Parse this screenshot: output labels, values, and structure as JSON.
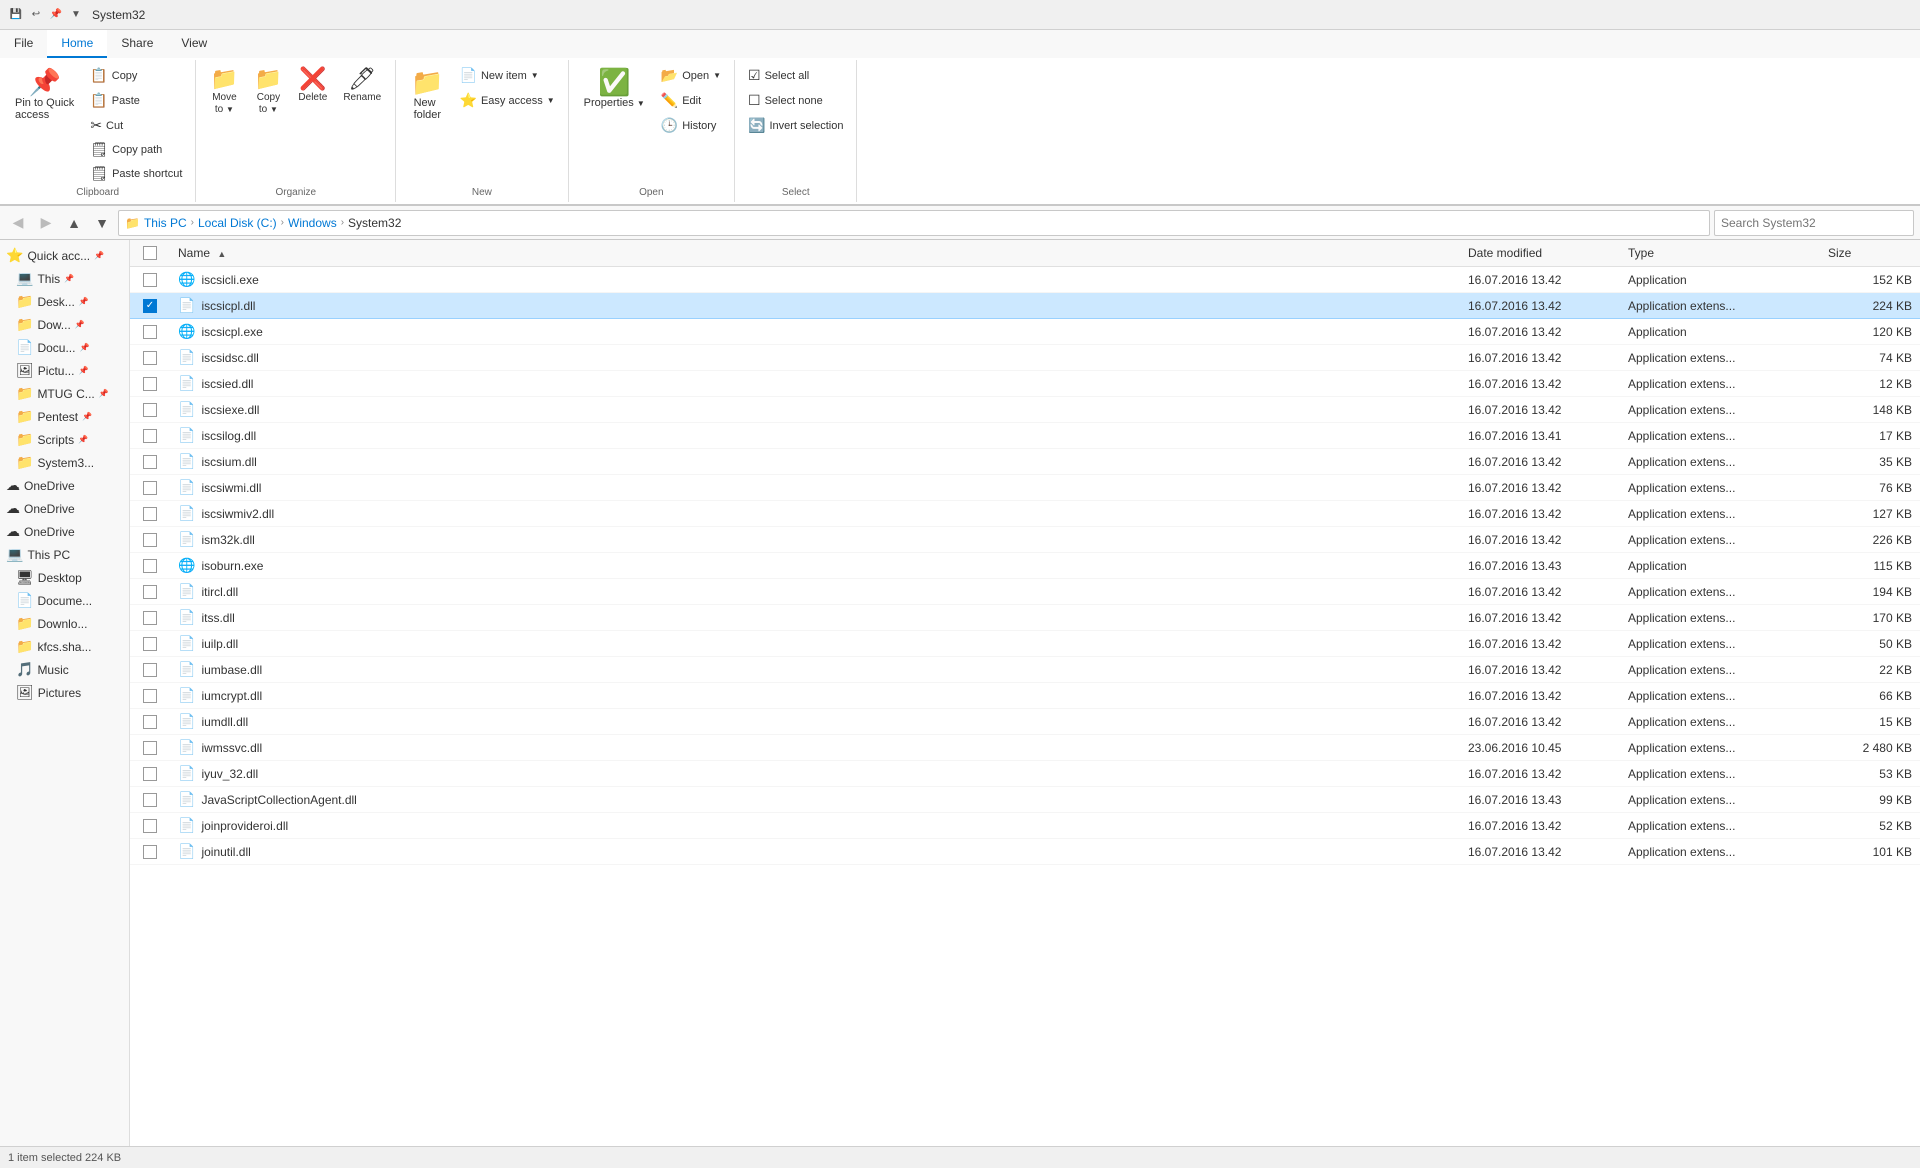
{
  "titlebar": {
    "title": "System32",
    "icons": [
      "save-icon",
      "undo-icon",
      "pin-icon",
      "dropdown-icon"
    ]
  },
  "ribbon": {
    "tabs": [
      {
        "id": "file",
        "label": "File"
      },
      {
        "id": "home",
        "label": "Home",
        "active": true
      },
      {
        "id": "share",
        "label": "Share"
      },
      {
        "id": "view",
        "label": "View"
      }
    ],
    "groups": {
      "clipboard": {
        "label": "Clipboard",
        "buttons": [
          {
            "id": "pin-to-quick",
            "label": "Pin to Quick\naccess",
            "icon": "📌"
          },
          {
            "id": "copy",
            "label": "Copy",
            "icon": "📋"
          },
          {
            "id": "paste",
            "label": "Paste",
            "icon": "📋"
          },
          {
            "id": "cut",
            "label": "Cut",
            "icon": "✂️"
          },
          {
            "id": "copy-path",
            "label": "Copy path",
            "icon": "🗒"
          },
          {
            "id": "paste-shortcut",
            "label": "Paste shortcut",
            "icon": "🗒"
          }
        ]
      },
      "organize": {
        "label": "Organize",
        "buttons": [
          {
            "id": "move-to",
            "label": "Move\nto",
            "icon": "📁"
          },
          {
            "id": "copy-to",
            "label": "Copy\nto",
            "icon": "📁"
          },
          {
            "id": "delete",
            "label": "Delete",
            "icon": "❌"
          },
          {
            "id": "rename",
            "label": "Rename",
            "icon": "🖊"
          }
        ]
      },
      "new": {
        "label": "New",
        "buttons": [
          {
            "id": "new-folder",
            "label": "New\nfolder",
            "icon": "📁"
          },
          {
            "id": "new-item",
            "label": "New item",
            "icon": "📄"
          },
          {
            "id": "easy-access",
            "label": "Easy access",
            "icon": "⭐"
          }
        ]
      },
      "open": {
        "label": "Open",
        "buttons": [
          {
            "id": "open",
            "label": "Open",
            "icon": "📂"
          },
          {
            "id": "edit",
            "label": "Edit",
            "icon": "✏️"
          },
          {
            "id": "history",
            "label": "History",
            "icon": "🕒"
          },
          {
            "id": "properties",
            "label": "Properties",
            "icon": "✅"
          }
        ]
      },
      "select": {
        "label": "Select",
        "buttons": [
          {
            "id": "select-all",
            "label": "Select all",
            "icon": "☑"
          },
          {
            "id": "select-none",
            "label": "Select none",
            "icon": "☐"
          },
          {
            "id": "invert-selection",
            "label": "Invert selection",
            "icon": "🔄"
          }
        ]
      }
    }
  },
  "breadcrumb": {
    "items": [
      {
        "label": "This PC"
      },
      {
        "label": "Local Disk (C:)"
      },
      {
        "label": "Windows"
      },
      {
        "label": "System32"
      }
    ],
    "search_placeholder": "Search System32"
  },
  "sidebar": {
    "items": [
      {
        "icon": "⭐",
        "label": "Quick acc...",
        "pinned": true,
        "type": "quick-access"
      },
      {
        "icon": "💻",
        "label": "This",
        "pinned": true,
        "type": "this-pc-shortcut"
      },
      {
        "icon": "📁",
        "label": "Desk...",
        "pinned": true,
        "type": "desktop"
      },
      {
        "icon": "📁",
        "label": "Dow...",
        "pinned": true,
        "type": "downloads"
      },
      {
        "icon": "📄",
        "label": "Docu...",
        "pinned": true,
        "type": "documents"
      },
      {
        "icon": "🖼",
        "label": "Pictu...",
        "pinned": true,
        "type": "pictures"
      },
      {
        "icon": "📁",
        "label": "MTUG C...",
        "pinned": true,
        "type": "mtug"
      },
      {
        "icon": "📁",
        "label": "Pentest",
        "pinned": true,
        "type": "pentest"
      },
      {
        "icon": "📁",
        "label": "Scripts",
        "pinned": true,
        "type": "scripts"
      },
      {
        "icon": "📁",
        "label": "System3...",
        "pinned": false,
        "type": "system32"
      },
      {
        "icon": "☁",
        "label": "OneDrive",
        "pinned": false,
        "type": "onedrive1"
      },
      {
        "icon": "☁",
        "label": "OneDrive",
        "pinned": false,
        "type": "onedrive2"
      },
      {
        "icon": "☁",
        "label": "OneDrive",
        "pinned": false,
        "type": "onedrive3"
      },
      {
        "icon": "💻",
        "label": "This PC",
        "pinned": false,
        "type": "this-pc"
      },
      {
        "icon": "🖥",
        "label": "Desktop",
        "pinned": false,
        "type": "desktop2"
      },
      {
        "icon": "📄",
        "label": "Docume...",
        "pinned": false,
        "type": "documents2"
      },
      {
        "icon": "📁",
        "label": "Downlo...",
        "pinned": false,
        "type": "downloads2"
      },
      {
        "icon": "📁",
        "label": "kfcs.sha...",
        "pinned": false,
        "type": "kfcs"
      },
      {
        "icon": "🎵",
        "label": "Music",
        "pinned": false,
        "type": "music"
      },
      {
        "icon": "🖼",
        "label": "Pictures",
        "pinned": false,
        "type": "pictures2"
      }
    ]
  },
  "filelist": {
    "columns": [
      "",
      "Name",
      "Date modified",
      "Type",
      "Size"
    ],
    "files": [
      {
        "id": "iscsicli",
        "name": "iscsicli.exe",
        "date": "16.07.2016 13.42",
        "type": "Application",
        "size": "152 KB",
        "icon": "exe",
        "selected": false
      },
      {
        "id": "iscsicpl-dll",
        "name": "iscsicpl.dll",
        "date": "16.07.2016 13.42",
        "type": "Application extens...",
        "size": "224 KB",
        "icon": "dll",
        "selected": true
      },
      {
        "id": "iscsicpl-exe",
        "name": "iscsicpl.exe",
        "date": "16.07.2016 13.42",
        "type": "Application",
        "size": "120 KB",
        "icon": "exe",
        "selected": false
      },
      {
        "id": "iscsidsc",
        "name": "iscsidsc.dll",
        "date": "16.07.2016 13.42",
        "type": "Application extens...",
        "size": "74 KB",
        "icon": "dll",
        "selected": false
      },
      {
        "id": "iscsied",
        "name": "iscsied.dll",
        "date": "16.07.2016 13.42",
        "type": "Application extens...",
        "size": "12 KB",
        "icon": "dll",
        "selected": false
      },
      {
        "id": "iscsiexe",
        "name": "iscsiexe.dll",
        "date": "16.07.2016 13.42",
        "type": "Application extens...",
        "size": "148 KB",
        "icon": "dll",
        "selected": false
      },
      {
        "id": "iscsilog",
        "name": "iscsilog.dll",
        "date": "16.07.2016 13.41",
        "type": "Application extens...",
        "size": "17 KB",
        "icon": "dll",
        "selected": false
      },
      {
        "id": "iscsium",
        "name": "iscsium.dll",
        "date": "16.07.2016 13.42",
        "type": "Application extens...",
        "size": "35 KB",
        "icon": "dll",
        "selected": false
      },
      {
        "id": "iscsiwmi",
        "name": "iscsiwmi.dll",
        "date": "16.07.2016 13.42",
        "type": "Application extens...",
        "size": "76 KB",
        "icon": "dll",
        "selected": false
      },
      {
        "id": "iscsiwmiv2",
        "name": "iscsiwmiv2.dll",
        "date": "16.07.2016 13.42",
        "type": "Application extens...",
        "size": "127 KB",
        "icon": "dll",
        "selected": false
      },
      {
        "id": "ism32k",
        "name": "ism32k.dll",
        "date": "16.07.2016 13.42",
        "type": "Application extens...",
        "size": "226 KB",
        "icon": "dll",
        "selected": false
      },
      {
        "id": "isoburn",
        "name": "isoburn.exe",
        "date": "16.07.2016 13.43",
        "type": "Application",
        "size": "115 KB",
        "icon": "exe",
        "selected": false
      },
      {
        "id": "itircl",
        "name": "itircl.dll",
        "date": "16.07.2016 13.42",
        "type": "Application extens...",
        "size": "194 KB",
        "icon": "dll",
        "selected": false
      },
      {
        "id": "itss",
        "name": "itss.dll",
        "date": "16.07.2016 13.42",
        "type": "Application extens...",
        "size": "170 KB",
        "icon": "dll",
        "selected": false
      },
      {
        "id": "iuilp",
        "name": "iuilp.dll",
        "date": "16.07.2016 13.42",
        "type": "Application extens...",
        "size": "50 KB",
        "icon": "dll",
        "selected": false
      },
      {
        "id": "iumbase",
        "name": "iumbase.dll",
        "date": "16.07.2016 13.42",
        "type": "Application extens...",
        "size": "22 KB",
        "icon": "dll",
        "selected": false
      },
      {
        "id": "iumcrypt",
        "name": "iumcrypt.dll",
        "date": "16.07.2016 13.42",
        "type": "Application extens...",
        "size": "66 KB",
        "icon": "dll",
        "selected": false
      },
      {
        "id": "iumdll",
        "name": "iumdll.dll",
        "date": "16.07.2016 13.42",
        "type": "Application extens...",
        "size": "15 KB",
        "icon": "dll",
        "selected": false
      },
      {
        "id": "iwmssvc",
        "name": "iwmssvc.dll",
        "date": "23.06.2016 10.45",
        "type": "Application extens...",
        "size": "2 480 KB",
        "icon": "dll",
        "selected": false
      },
      {
        "id": "iyuv32",
        "name": "iyuv_32.dll",
        "date": "16.07.2016 13.42",
        "type": "Application extens...",
        "size": "53 KB",
        "icon": "dll",
        "selected": false
      },
      {
        "id": "javascript",
        "name": "JavaScriptCollectionAgent.dll",
        "date": "16.07.2016 13.43",
        "type": "Application extens...",
        "size": "99 KB",
        "icon": "dll",
        "selected": false
      },
      {
        "id": "joinprovider",
        "name": "joinprovideroi.dll",
        "date": "16.07.2016 13.42",
        "type": "Application extens...",
        "size": "52 KB",
        "icon": "dll",
        "selected": false
      },
      {
        "id": "joinutil",
        "name": "joinutil.dll",
        "date": "16.07.2016 13.42",
        "type": "Application extens...",
        "size": "101 KB",
        "icon": "dll",
        "selected": false
      }
    ]
  },
  "statusbar": {
    "text": "1 item selected  224 KB"
  }
}
